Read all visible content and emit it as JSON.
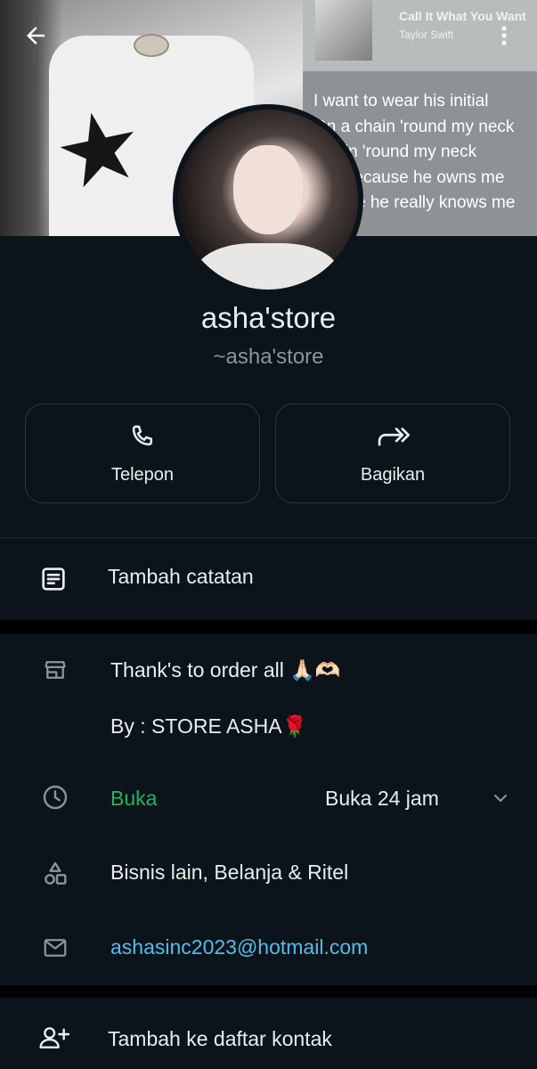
{
  "cover": {
    "song_title": "Call It What You Want",
    "song_artist": "Taylor Swift",
    "lyrics": [
      "I want to wear his initial",
      "On a chain 'round my neck",
      "Chain 'round my neck",
      "Not because he owns me",
      "'Cause he really knows me"
    ]
  },
  "header": {
    "back_icon": "arrow-left-icon",
    "menu_icon": "more-vertical-icon"
  },
  "profile": {
    "name": "asha'store",
    "username": "~asha'store"
  },
  "actions": {
    "call_label": "Telepon",
    "share_label": "Bagikan"
  },
  "note": {
    "label": "Tambah catatan"
  },
  "business": {
    "description_line1": "Thank's to order all 🙏🏻🫶🏻",
    "description_line2": "By : STORE ASHA🌹",
    "hours_status": "Buka",
    "hours_detail": "Buka 24 jam",
    "category": "Bisnis lain, Belanja & Ritel",
    "email": "ashasinc2023@hotmail.com"
  },
  "contact": {
    "add_label": "Tambah ke daftar kontak"
  },
  "colors": {
    "background": "#0b141a",
    "open_green": "#25b35c",
    "link_blue": "#53bdeb",
    "secondary_text": "#8696a0"
  }
}
